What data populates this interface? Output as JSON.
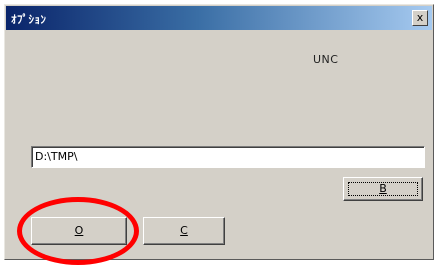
{
  "window": {
    "title": "ｵﾌﾟｼｮﾝ",
    "close_glyph": "x"
  },
  "label": {
    "unc": "UNC"
  },
  "path_field": {
    "value": "D:\\TMP\\"
  },
  "buttons": {
    "browse_label": "B",
    "ok_label": "O",
    "cancel_label": "C"
  },
  "annotation": {
    "color": "#ff0000"
  }
}
